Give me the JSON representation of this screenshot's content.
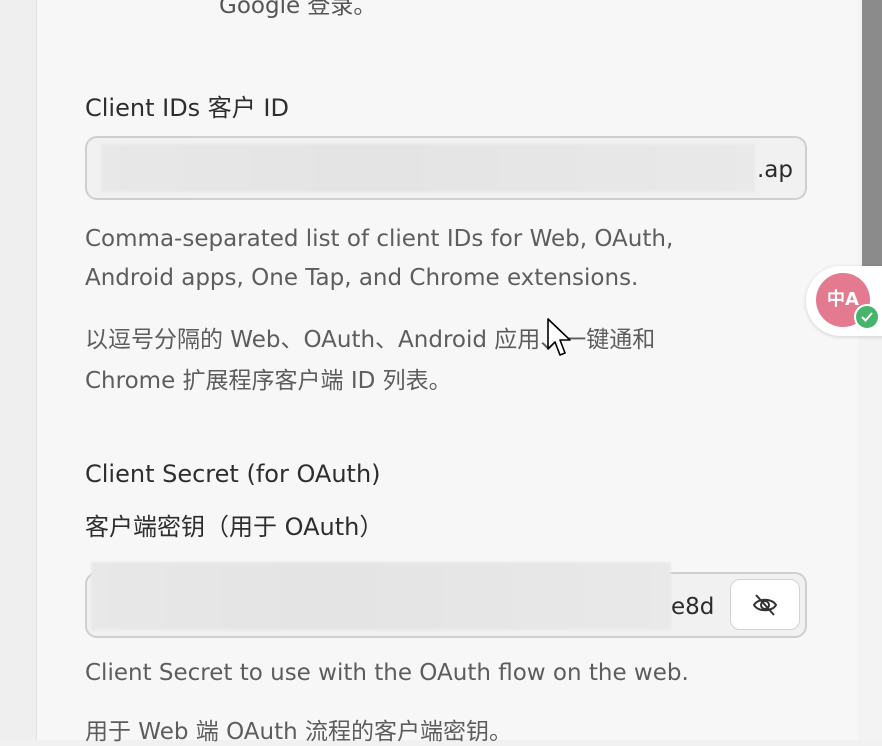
{
  "top_cut_text": "Google 登录。",
  "client_ids": {
    "label": "Client IDs  客户 ID",
    "value_tail": ".ap",
    "desc_en_line1": "Comma-separated list of client IDs for Web, OAuth,",
    "desc_en_line2": "Android apps, One Tap, and Chrome extensions.",
    "desc_zh_line1": "以逗号分隔的 Web、OAuth、Android 应用、一键通和",
    "desc_zh_line2": "Chrome 扩展程序客户端 ID 列表。"
  },
  "client_secret": {
    "label_en": "Client Secret (for OAuth)",
    "label_zh": "客户端密钥（用于 OAuth）",
    "value_tail": "e8d",
    "desc_en": "Client Secret to use with the OAuth flow on the web.",
    "desc_zh": "用于 Web 端 OAuth 流程的客户端密钥。"
  },
  "translate_badge": {
    "glyph": "中A",
    "icon": "translate-icon",
    "status_icon": "check-icon",
    "color": "#e37a8f"
  },
  "icons": {
    "visibility_toggle": "eye-off-icon"
  }
}
